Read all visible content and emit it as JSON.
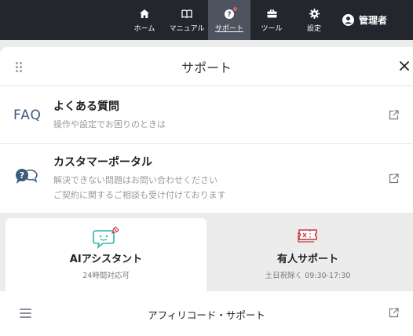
{
  "nav": {
    "items": [
      {
        "label": "ホーム",
        "icon": "home-icon"
      },
      {
        "label": "マニュアル",
        "icon": "book-icon"
      },
      {
        "label": "サポート",
        "icon": "question-icon",
        "active": true
      },
      {
        "label": "ツール",
        "icon": "toolbox-icon"
      },
      {
        "label": "設定",
        "icon": "gear-icon"
      }
    ],
    "user_label": "管理者"
  },
  "panel": {
    "title": "サポート",
    "faq": {
      "icon_text": "FAQ",
      "title": "よくある質問",
      "desc": "操作や設定でお困りのときは"
    },
    "portal": {
      "title": "カスタマーポータル",
      "desc_line1": "解決できない問題はお問い合わせください",
      "desc_line2": "ご契約に関するご相談も受け付けております"
    },
    "tabs": [
      {
        "title": "AIアシスタント",
        "sub": "24時間対応可"
      },
      {
        "title": "有人サポート",
        "sub": "土日祝除く 09:30-17:30"
      }
    ],
    "bottom_title": "アフィリコード・サポート"
  },
  "colors": {
    "topbar": "#23262c",
    "active_nav": "#4d5460",
    "badge": "#e05a63",
    "ai_icon": "#2fb3b0",
    "human_icon": "#c8373c",
    "faq_text": "#3d5b7c"
  }
}
